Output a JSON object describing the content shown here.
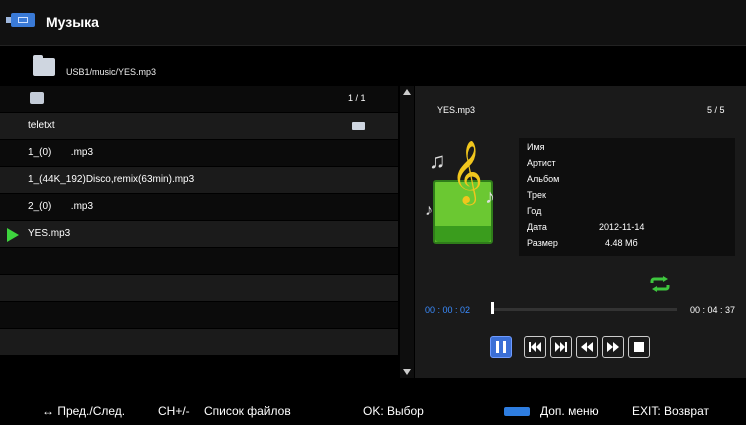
{
  "header": {
    "title": "Музыка"
  },
  "path": {
    "text": "USB1/music/YES.mp3"
  },
  "list": {
    "page": "1 / 1",
    "items": [
      {
        "label": ""
      },
      {
        "label": "teletxt"
      },
      {
        "label": "1_(0)       .mp3"
      },
      {
        "label": "1_(44K_192)Disco,remix(63min).mp3"
      },
      {
        "label": "2_(0)       .mp3"
      },
      {
        "label": "YES.mp3"
      }
    ]
  },
  "panel": {
    "file_name": "YES.mp3",
    "file_count": "5 / 5",
    "info_keys": [
      "Имя",
      "Артист",
      "Альбом",
      "Трек",
      "Год",
      "Дата",
      "Размер"
    ],
    "info_values": [
      "",
      "",
      "",
      "",
      "",
      "2012-11-14",
      "4.48 Мб"
    ],
    "time_current": "00 : 00 : 02",
    "time_total": "00 : 04 : 37",
    "progress_fraction": 0.0
  },
  "bottom": {
    "prev_next": "↔ Пред./След.",
    "ch": "CH+/-",
    "file_list": "Список файлов",
    "ok": "OK: Выбор",
    "menu": "Доп. меню",
    "exit": "EXIT: Возврат"
  },
  "colors": {
    "accent": "#3b6fd6",
    "play_marker": "#3ed43e",
    "repeat": "#3ec63e"
  }
}
